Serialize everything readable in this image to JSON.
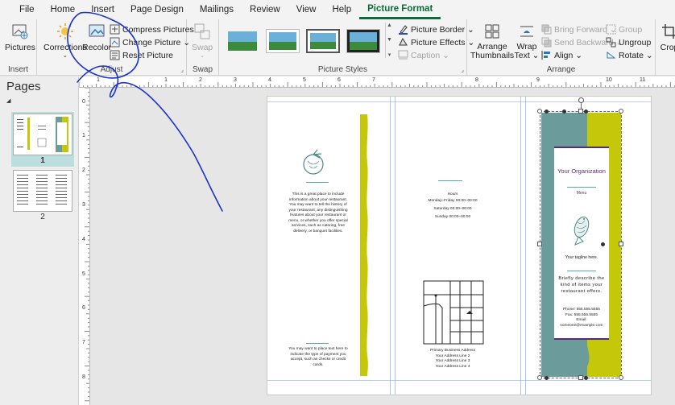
{
  "tabs": [
    "File",
    "Home",
    "Insert",
    "Page Design",
    "Mailings",
    "Review",
    "View",
    "Help",
    "Picture Format"
  ],
  "active_tab": "Picture Format",
  "ribbon": {
    "insert": {
      "pictures": "Pictures",
      "label": "Insert"
    },
    "adjust": {
      "corrections": "Corrections",
      "recolor": "Recolor",
      "compress": "Compress Pictures",
      "change": "Change Picture ⌄",
      "reset": "Reset Picture",
      "label": "Adjust"
    },
    "swap": {
      "swap": "Swap",
      "label": "Swap"
    },
    "picture_styles": {
      "border": "Picture Border ⌄",
      "effects": "Picture Effects ⌄",
      "caption": "Caption ⌄",
      "label": "Picture Styles"
    },
    "arrange": {
      "arrange_thumbnails": "Arrange Thumbnails",
      "wrap_text": "Wrap Text ⌄",
      "bring_forward": "Bring Forward ⌄",
      "send_backward": "Send Backward ⌄",
      "align": "Align ⌄",
      "group": "Group",
      "ungroup": "Ungroup",
      "rotate": "Rotate ⌄",
      "label": "Arrange"
    },
    "crop": "Crop"
  },
  "pages_pane": {
    "title": "Pages",
    "pages": [
      "1",
      "2"
    ]
  },
  "ruler_h": [
    "1",
    "1",
    "2",
    "3",
    "4",
    "5",
    "6",
    "7",
    "8",
    "9",
    "10",
    "11"
  ],
  "ruler_v": [
    "0",
    "1",
    "2",
    "3",
    "4",
    "5",
    "6",
    "7",
    "8"
  ],
  "doc": {
    "panel1_body": "This is a great place to include information about your restaurant. You may want to tell the history of your restaurant, any distinguishing features about your restaurant or menu, or whether you offer special services, such as catering, free delivery, or banquet facilities.",
    "panel1_footer": "You may want to place text here to indicate the type of payment you accept, such as checks or credit cards.",
    "panel2_hours_title": "Hours",
    "panel2_hours_1": "Monday–Friday 00:00–00:00",
    "panel2_hours_2": "Saturday 00:00–00:00",
    "panel2_hours_3": "Sunday 00:00–00:00",
    "panel2_address": "Primary Business Address\nYour Address Line 2\nYour Address Line 3\nYour Address Line 4",
    "panel3_org": "Your Organization",
    "panel3_menu": "Menu",
    "panel3_tagline": "Your tagline here.",
    "panel3_desc": "Briefly describe the kind of items your restaurant offers.",
    "panel3_contact": "Phone: 555.555.5555\nFax: 555.555.5555\nEmail:\nsomeone@example.com"
  },
  "colors": {
    "accent": "#0e6a3a",
    "teal": "#6c9b9c",
    "chartreuse": "#c5c80a",
    "purple": "#5a2a7a",
    "ink": "#1a33cc"
  }
}
